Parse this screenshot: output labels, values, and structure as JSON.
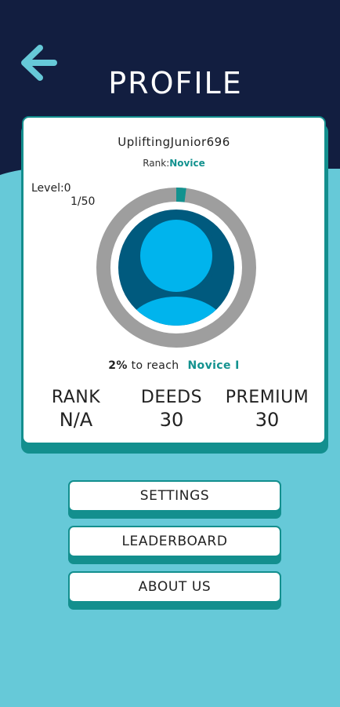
{
  "header": {
    "title": "PROFILE",
    "back_icon": "arrow-left-icon"
  },
  "colors": {
    "header_bg": "#121e40",
    "page_bg": "#66c9d8",
    "accent": "#13928f",
    "avatar_bg": "#005a7e",
    "avatar_fg": "#00b4ed",
    "ring_track": "#9e9e9e",
    "ring_fill": "#13928f"
  },
  "profile": {
    "username": "UpliftingJunior696",
    "rank_prefix": "Rank:",
    "rank_value": "Novice",
    "level_text": "Level:0",
    "xp_text": "1/50",
    "progress_fraction": 0.02,
    "avatar_icon": "user-avatar-icon",
    "progress_percent_text": "2%",
    "progress_mid_text": "to reach",
    "next_rank": "Novice I"
  },
  "stats": [
    {
      "label": "RANK",
      "value": "N/A"
    },
    {
      "label": "DEEDS",
      "value": "30"
    },
    {
      "label": "PREMIUM",
      "value": "30"
    }
  ],
  "menu": {
    "settings": "SETTINGS",
    "leaderboard": "LEADERBOARD",
    "about": "ABOUT US"
  }
}
